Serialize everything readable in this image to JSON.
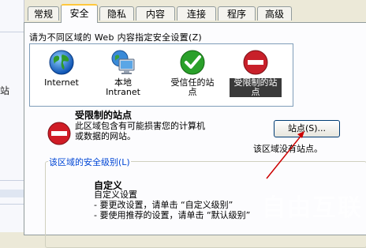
{
  "tabs": [
    {
      "label": "常规",
      "active": false
    },
    {
      "label": "安全",
      "active": true
    },
    {
      "label": "隐私",
      "active": false
    },
    {
      "label": "内容",
      "active": false
    },
    {
      "label": "连接",
      "active": false
    },
    {
      "label": "程序",
      "active": false
    },
    {
      "label": "高级",
      "active": false
    }
  ],
  "security": {
    "prompt": "请为不同区域的 Web 内容指定安全设置(Z)",
    "zones": [
      {
        "label": "Internet",
        "icon": "globe-icon"
      },
      {
        "label": "本地 Intranet",
        "icon": "monitor-icon"
      },
      {
        "label": "受信任的站点",
        "icon": "check-circle-icon"
      },
      {
        "label": "受限制的站点",
        "icon": "no-entry-icon",
        "selected": true
      }
    ],
    "selected_zone": {
      "title": "受限制的站点",
      "desc1": "此区域包含有可能损害您的计算机",
      "desc2": "或数据的网站。",
      "sites_button": "站点(S)...",
      "no_sites": "该区域没有站点。"
    },
    "level": {
      "group_title": "该区域的安全级别(L)",
      "name": "自定义",
      "line1": "自定义设置",
      "line2": "- 要更改设置，请单击 “自定义级别”",
      "line3": "- 要使用推荐的设置，请单击 “默认级别”"
    }
  },
  "background": {
    "left_fragment": "站"
  },
  "watermark": "自由互联",
  "colors": {
    "arrow": "#cc0000",
    "selected_zone_bg": "#3a3a3a",
    "tab_highlight": "#ffc83c",
    "group_title": "#0046d5"
  }
}
